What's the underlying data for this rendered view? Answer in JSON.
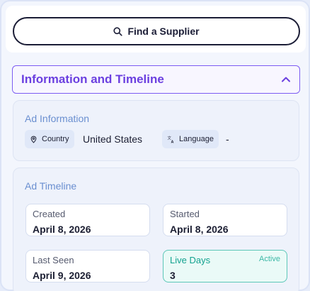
{
  "find_supplier": {
    "label": "Find a Supplier",
    "icon": "search-icon"
  },
  "section": {
    "title": "Information and Timeline",
    "state": "expanded"
  },
  "ad_information": {
    "title": "Ad Information",
    "country_label": "Country",
    "country_value": "United States",
    "language_label": "Language",
    "language_value": "-"
  },
  "ad_timeline": {
    "title": "Ad Timeline",
    "created_label": "Created",
    "created_value": "April 8, 2026",
    "started_label": "Started",
    "started_value": "April 8, 2026",
    "last_seen_label": "Last Seen",
    "last_seen_value": "April 9, 2026",
    "live_days_label": "Live Days",
    "live_days_value": "3",
    "live_days_badge": "Active"
  },
  "colors": {
    "accent": "#6b3fe0",
    "active": "#13a28f",
    "muted_title": "#6a8fd0"
  }
}
